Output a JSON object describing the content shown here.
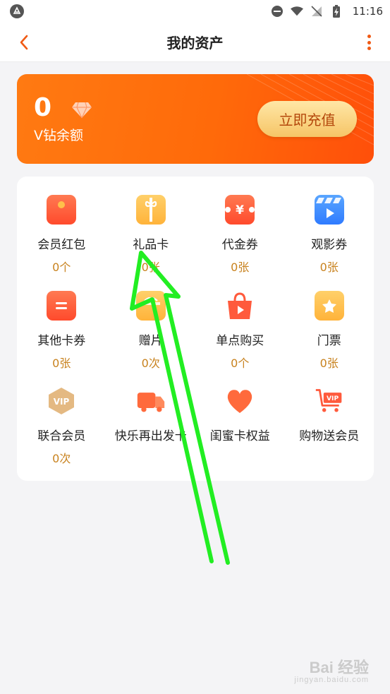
{
  "status_bar": {
    "time": "11:16"
  },
  "header": {
    "title": "我的资产"
  },
  "balance": {
    "value": "0",
    "label": "V钻余额",
    "recharge_label": "立即充值"
  },
  "assets": [
    {
      "name": "会员红包",
      "count": "0个",
      "icon": "red-envelope-icon",
      "color": "#ff5a3c"
    },
    {
      "name": "礼品卡",
      "count": "0张",
      "icon": "gift-card-icon",
      "color": "#ffbe52"
    },
    {
      "name": "代金券",
      "count": "0张",
      "icon": "voucher-icon",
      "color": "#ff5a3c"
    },
    {
      "name": "观影券",
      "count": "0张",
      "icon": "movie-ticket-icon",
      "color": "#3d8bff"
    },
    {
      "name": "其他卡券",
      "count": "0张",
      "icon": "other-coupon-icon",
      "color": "#ff5a3c"
    },
    {
      "name": "赠片",
      "count": "0次",
      "icon": "gift-film-icon",
      "color": "#ffbe52"
    },
    {
      "name": "单点购买",
      "count": "0个",
      "icon": "shopping-bag-icon",
      "color": "#ff5a3c"
    },
    {
      "name": "门票",
      "count": "0张",
      "icon": "ticket-star-icon",
      "color": "#ffbe52"
    },
    {
      "name": "联合会员",
      "count": "0次",
      "icon": "vip-badge-icon",
      "color": "#e0b27a"
    },
    {
      "name": "快乐再出发卡",
      "count": "",
      "icon": "truck-icon",
      "color": "#ff6a3c"
    },
    {
      "name": "闺蜜卡权益",
      "count": "",
      "icon": "heart-icon",
      "color": "#ff6a3c"
    },
    {
      "name": "购物送会员",
      "count": "",
      "icon": "vip-cart-icon",
      "color": "#ff5a3c"
    }
  ],
  "watermark": {
    "brand": "Bai 经验",
    "url": "jingyan.baidu.com"
  }
}
